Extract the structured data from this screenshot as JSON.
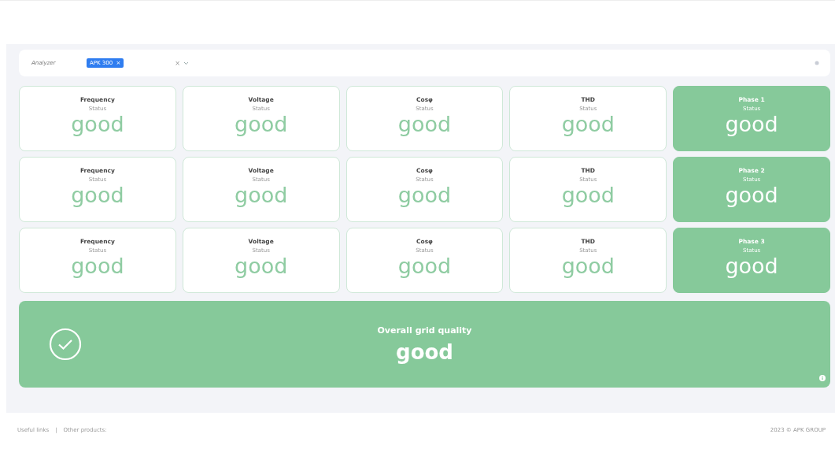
{
  "filter": {
    "label": "Analyzer",
    "chip": "APK 300",
    "chip_remove": "×",
    "clear": "×"
  },
  "rows": [
    [
      {
        "kind": "outline",
        "title": "Frequency",
        "caption": "Status",
        "value": "good"
      },
      {
        "kind": "outline",
        "title": "Voltage",
        "caption": "Status",
        "value": "good"
      },
      {
        "kind": "outline",
        "title": "Cosφ",
        "caption": "Status",
        "value": "good"
      },
      {
        "kind": "outline",
        "title": "THD",
        "caption": "Status",
        "value": "good"
      },
      {
        "kind": "filled",
        "title": "Phase 1",
        "caption": "Status",
        "value": "good"
      }
    ],
    [
      {
        "kind": "outline",
        "title": "Frequency",
        "caption": "Status",
        "value": "good"
      },
      {
        "kind": "outline",
        "title": "Voltage",
        "caption": "Status",
        "value": "good"
      },
      {
        "kind": "outline",
        "title": "Cosφ",
        "caption": "Status",
        "value": "good"
      },
      {
        "kind": "outline",
        "title": "THD",
        "caption": "Status",
        "value": "good"
      },
      {
        "kind": "filled",
        "title": "Phase 2",
        "caption": "Status",
        "value": "good"
      }
    ],
    [
      {
        "kind": "outline",
        "title": "Frequency",
        "caption": "Status",
        "value": "good"
      },
      {
        "kind": "outline",
        "title": "Voltage",
        "caption": "Status",
        "value": "good"
      },
      {
        "kind": "outline",
        "title": "Cosφ",
        "caption": "Status",
        "value": "good"
      },
      {
        "kind": "outline",
        "title": "THD",
        "caption": "Status",
        "value": "good"
      },
      {
        "kind": "filled",
        "title": "Phase 3",
        "caption": "Status",
        "value": "good"
      }
    ]
  ],
  "overall": {
    "title": "Overall grid quality",
    "value": "good"
  },
  "footer": {
    "links": [
      "Useful links",
      "Other products:"
    ],
    "separator": "|",
    "copyright": "2023 © APK GROUP"
  }
}
